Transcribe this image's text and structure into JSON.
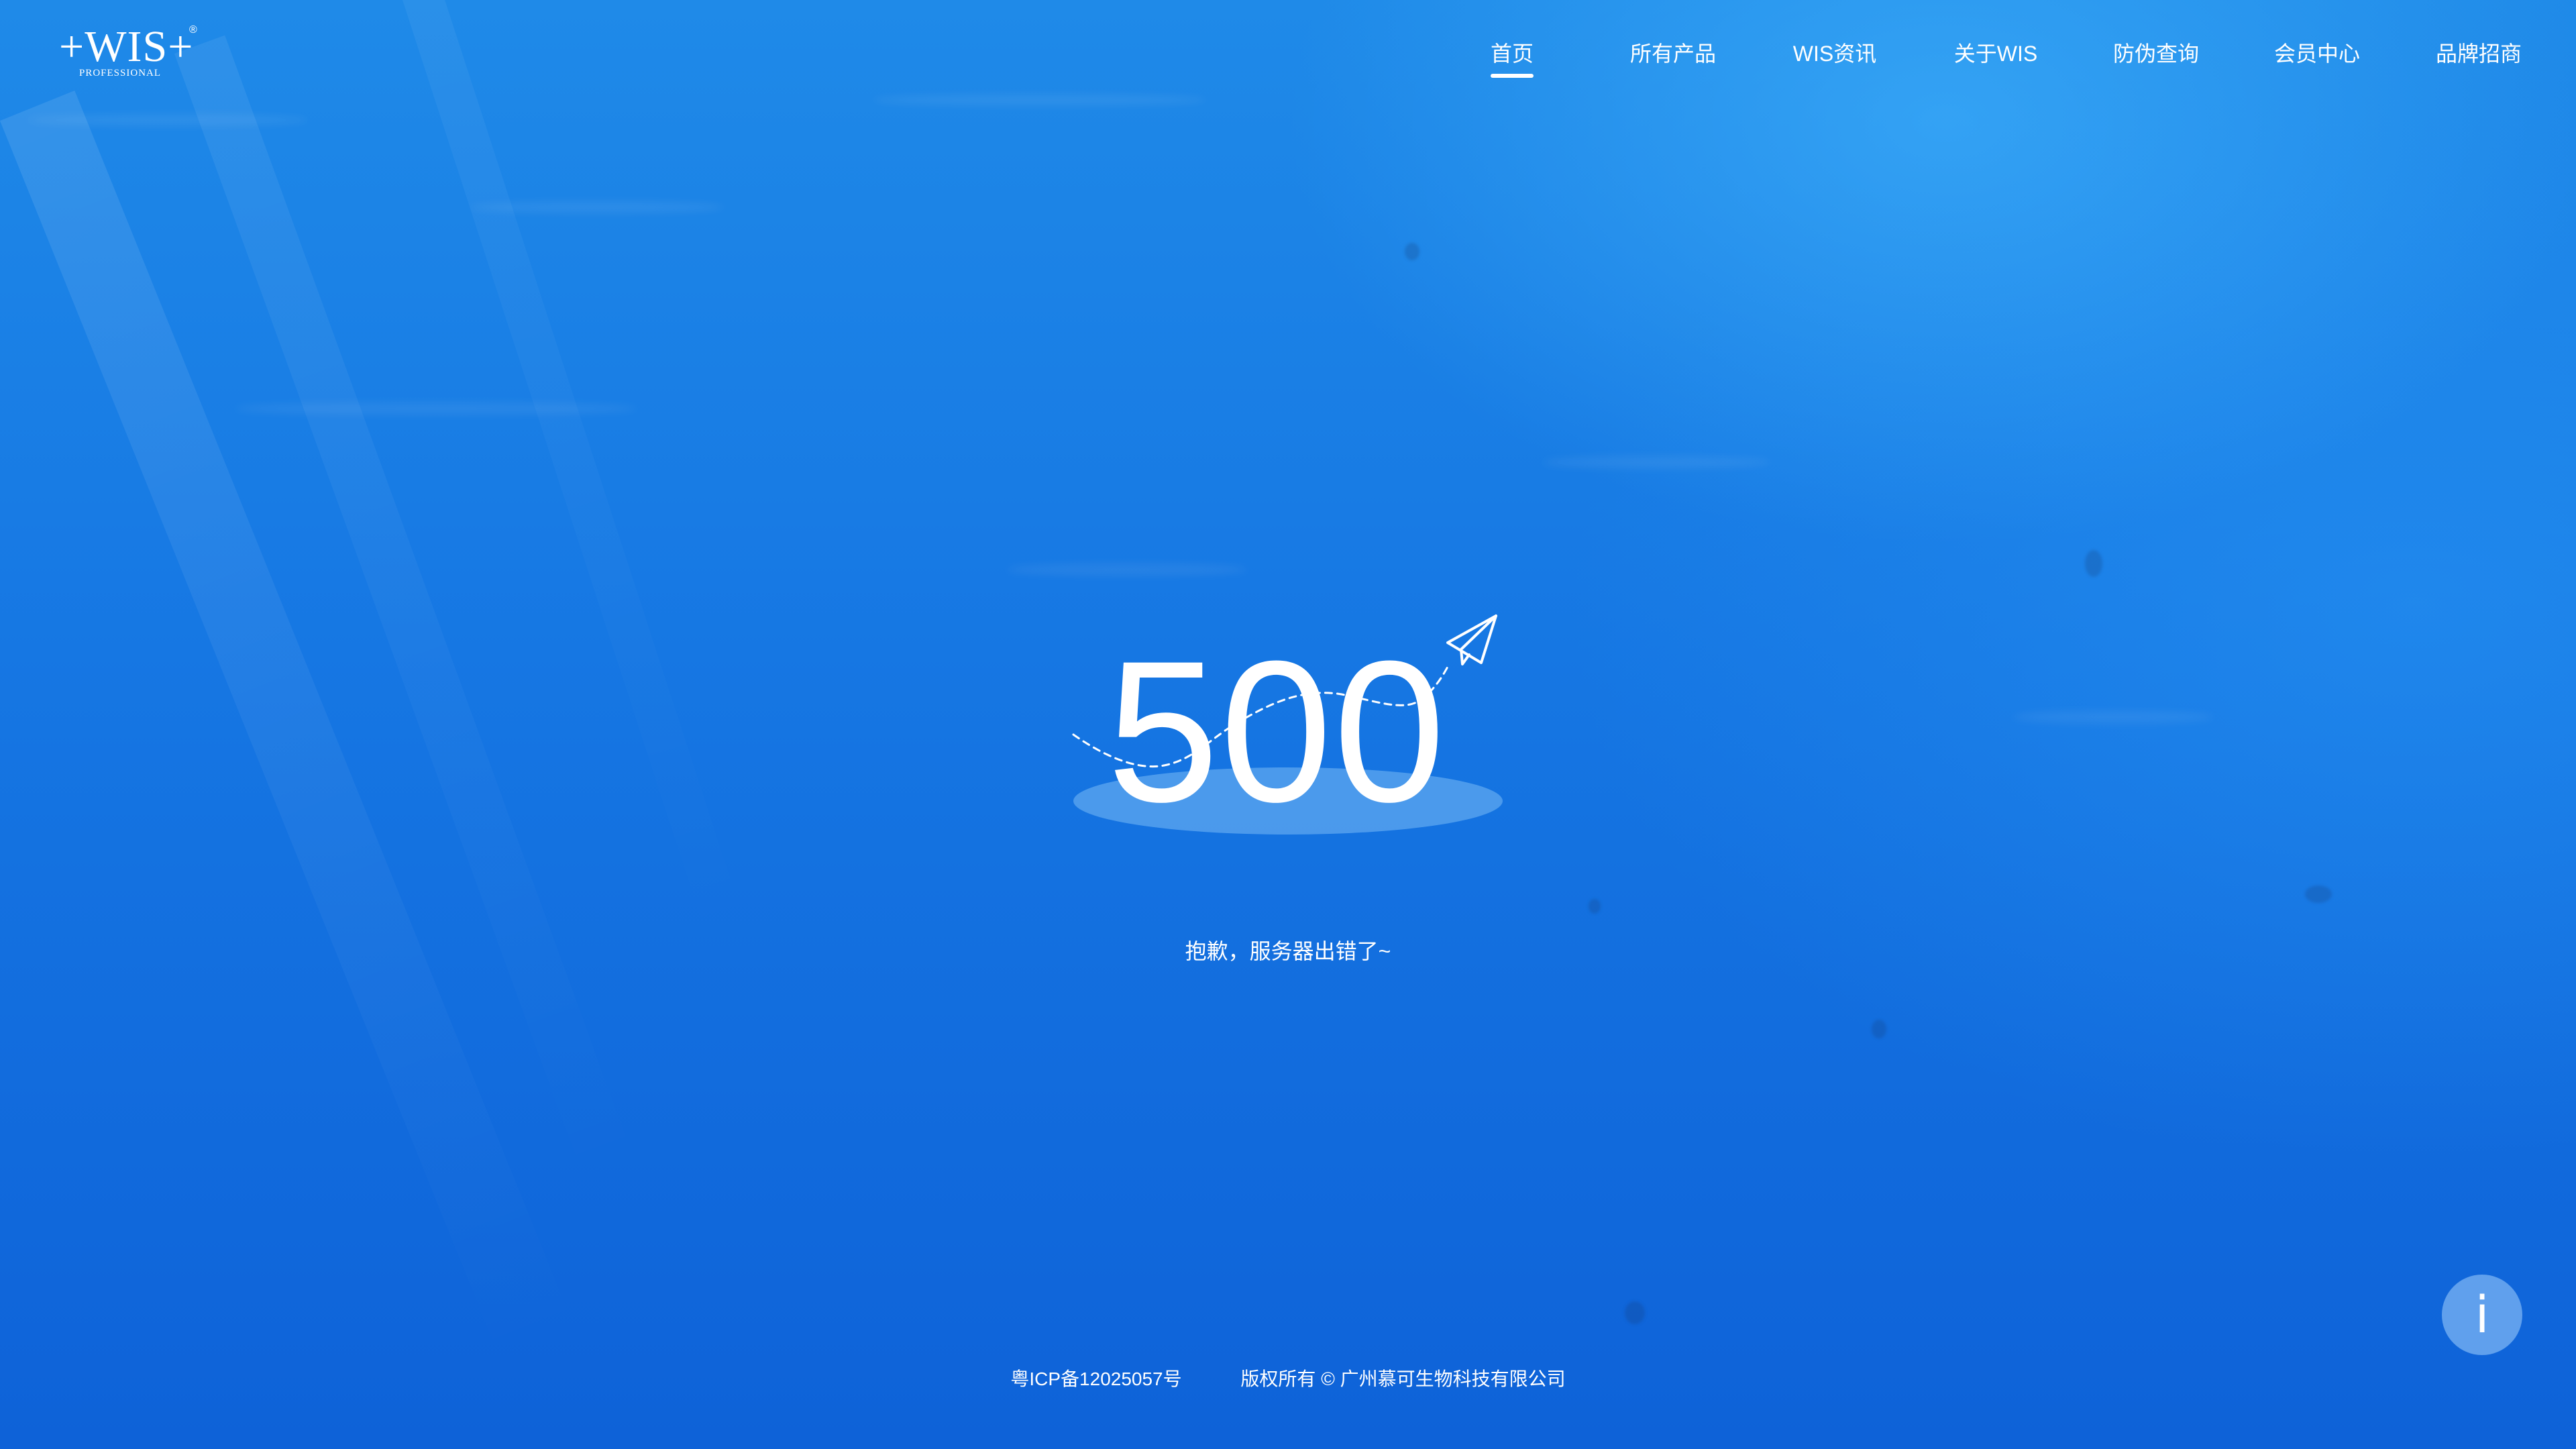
{
  "logo": {
    "main": "+WIS+",
    "registered": "®",
    "sub": "PROFESSIONAL"
  },
  "nav": {
    "items": [
      {
        "label": "首页",
        "active": true
      },
      {
        "label": "所有产品",
        "active": false
      },
      {
        "label": "WIS资讯",
        "active": false
      },
      {
        "label": "关于WIS",
        "active": false
      },
      {
        "label": "防伪查询",
        "active": false
      },
      {
        "label": "会员中心",
        "active": false
      },
      {
        "label": "品牌招商",
        "active": false
      }
    ]
  },
  "error": {
    "code": "500",
    "message": "抱歉，服务器出错了~"
  },
  "footer": {
    "icp": "粤ICP备12025057号",
    "copyright": "版权所有 © 广州慕可生物科技有限公司"
  },
  "info_button": {
    "icon": "info-icon",
    "glyph": "i"
  },
  "colors": {
    "background_top": "#1f8ae8",
    "background_bottom": "#0e62d8",
    "text": "#ffffff"
  }
}
